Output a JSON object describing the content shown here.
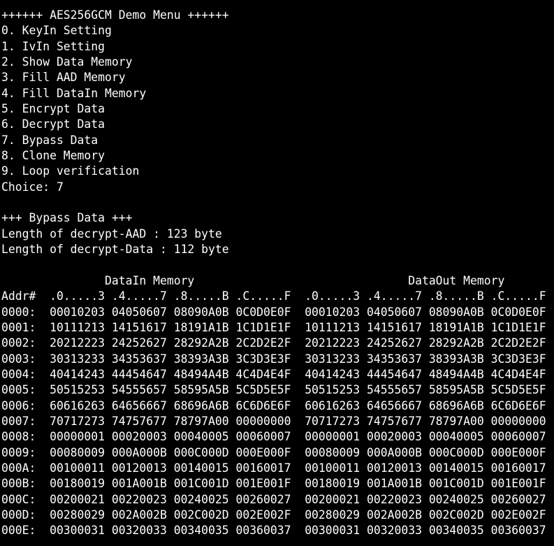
{
  "menu": {
    "title": "++++++ AES256GCM Demo Menu ++++++",
    "items": [
      "0. KeyIn Setting",
      "1. IvIn Setting",
      "2. Show Data Memory",
      "3. Fill AAD Memory",
      "4. Fill DataIn Memory",
      "5. Encrypt Data",
      "6. Decrypt Data",
      "7. Bypass Data",
      "8. Clone Memory",
      "9. Loop verification"
    ],
    "choice_prompt": "Choice: 7"
  },
  "bypass": {
    "header": "+++ Bypass Data +++",
    "aad_length": "Length of decrypt-AAD : 123 byte",
    "data_length": "Length of decrypt-Data : 112 byte"
  },
  "dump": {
    "section_titles": "               DataIn Memory                               DataOut Memory",
    "column_header": "Addr#  .0.....3 .4.....7 .8.....B .C.....F  .0.....3 .4.....7 .8.....B .C.....F",
    "rows": [
      "0000:  00010203 04050607 08090A0B 0C0D0E0F  00010203 04050607 08090A0B 0C0D0E0F",
      "0001:  10111213 14151617 18191A1B 1C1D1E1F  10111213 14151617 18191A1B 1C1D1E1F",
      "0002:  20212223 24252627 28292A2B 2C2D2E2F  20212223 24252627 28292A2B 2C2D2E2F",
      "0003:  30313233 34353637 38393A3B 3C3D3E3F  30313233 34353637 38393A3B 3C3D3E3F",
      "0004:  40414243 44454647 48494A4B 4C4D4E4F  40414243 44454647 48494A4B 4C4D4E4F",
      "0005:  50515253 54555657 58595A5B 5C5D5E5F  50515253 54555657 58595A5B 5C5D5E5F",
      "0006:  60616263 64656667 68696A6B 6C6D6E6F  60616263 64656667 68696A6B 6C6D6E6F",
      "0007:  70717273 74757677 78797A00 00000000  70717273 74757677 78797A00 00000000",
      "0008:  00000001 00020003 00040005 00060007  00000001 00020003 00040005 00060007",
      "0009:  00080009 000A000B 000C000D 000E000F  00080009 000A000B 000C000D 000E000F",
      "000A:  00100011 00120013 00140015 00160017  00100011 00120013 00140015 00160017",
      "000B:  00180019 001A001B 001C001D 001E001F  00180019 001A001B 001C001D 001E001F",
      "000C:  00200021 00220023 00240025 00260027  00200021 00220023 00240025 00260027",
      "000D:  00280029 002A002B 002C002D 002E002F  00280029 002A002B 002C002D 002E002F",
      "000E:  00300031 00320033 00340035 00360037  00300031 00320033 00340035 00360037"
    ]
  },
  "colors": {
    "background": "#000000",
    "foreground": "#ffffff"
  }
}
